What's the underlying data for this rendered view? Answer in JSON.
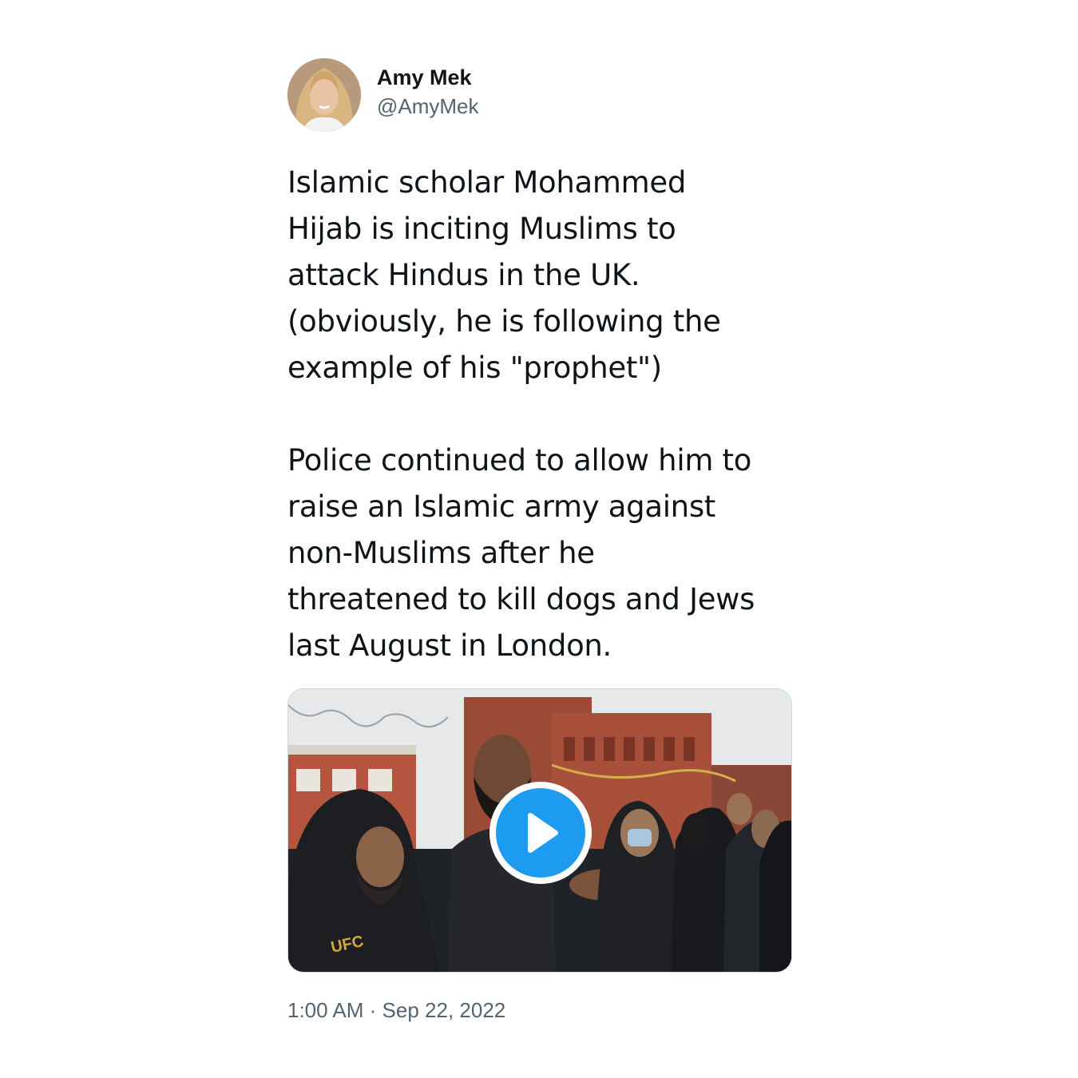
{
  "author": {
    "display_name": "Amy Mek",
    "handle": "@AmyMek"
  },
  "tweet": {
    "text": "Islamic scholar Mohammed\nHijab is inciting Muslims to\nattack Hindus in the UK.\n(obviously, he is following the\nexample of his \"prophet\")\n\nPolice continued to allow him to\nraise an Islamic army against\nnon-Muslims after he\nthreatened to kill dogs and Jews\nlast August in London.",
    "media": {
      "type": "video",
      "icon": "play-icon",
      "shirt_text": "UFC"
    },
    "time": "1:00 AM",
    "separator": "·",
    "date": "Sep 22, 2022"
  },
  "colors": {
    "accent": "#1d9bf0",
    "text": "#0f1419",
    "secondary": "#536471",
    "border": "#cfd9de"
  }
}
